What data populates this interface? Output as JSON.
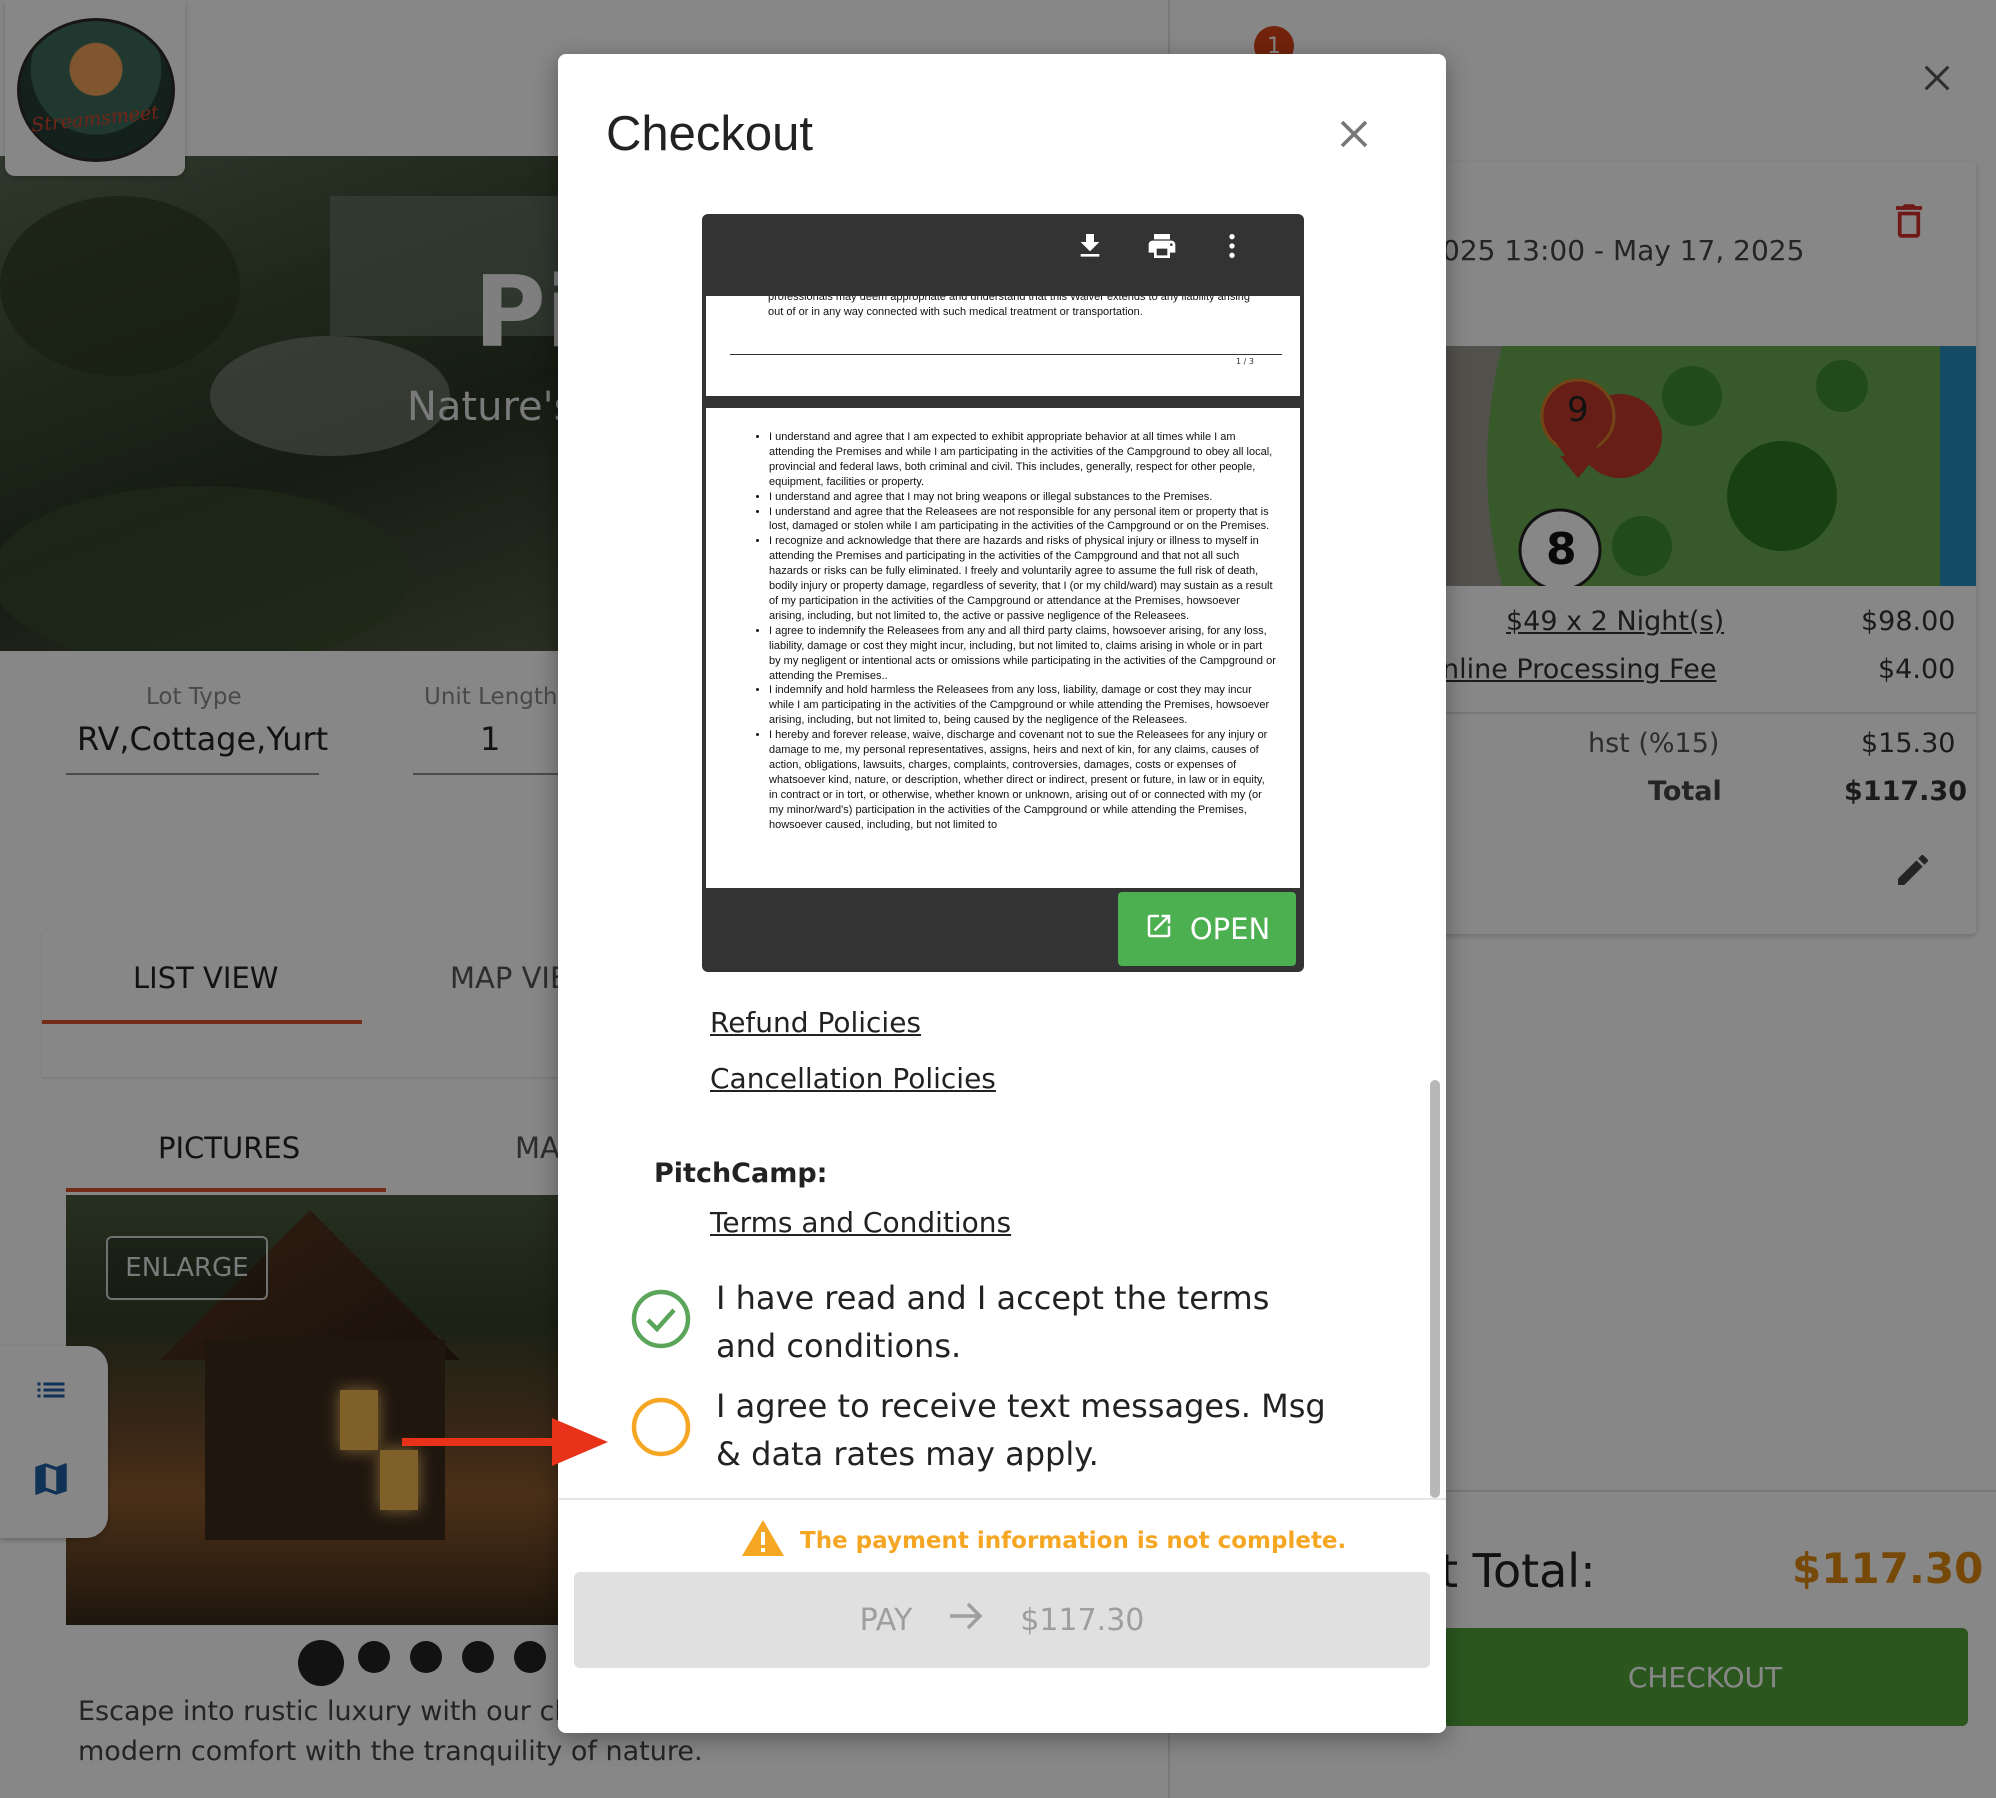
{
  "background": {
    "hero": {
      "title": "Pi",
      "subtitle": "Nature's"
    },
    "fields": [
      {
        "label": "Lot Type",
        "value": "RV,Cottage,Yurt"
      },
      {
        "label": "Unit Length",
        "value": "1"
      }
    ],
    "view_tabs": [
      "LIST VIEW",
      "MAP VIE"
    ],
    "media_tabs": [
      "PICTURES",
      "MA"
    ],
    "enlarge_label": "ENLARGE",
    "description": "Escape into rustic luxury with our cha getaway, combining modern comfort with the tranquility of nature."
  },
  "cart": {
    "badge_count": "1",
    "date_range": "025 13:00 - May 17, 2025",
    "map_markers": [
      "9",
      "8"
    ],
    "lines": [
      {
        "label": "$49 x 2 Night(s)",
        "value": "$98.00"
      },
      {
        "label": "nline Processing Fee",
        "value": "$4.00"
      },
      {
        "label": "hst (%15)",
        "value": "$15.30"
      },
      {
        "label": "Total",
        "value": "$117.30"
      }
    ],
    "grand_total_label": "t Total:",
    "grand_total_value": "$117.30",
    "checkout_label": "CHECKOUT"
  },
  "modal": {
    "title": "Checkout",
    "pdf": {
      "page1_tail": "professionals may deem appropriate and understand that this Waiver extends to any liability arising out of or in any way connected with such medical treatment or transportation.",
      "page_number": "1 / 3",
      "bullets": [
        "I understand and agree that I am expected to exhibit appropriate behavior at all times while I am attending the Premises and while I am participating in the activities of the Campground to obey all local, provincial and federal laws, both criminal and civil. This includes, generally, respect for other people, equipment, facilities or property.",
        "I understand and agree that I may not bring weapons or illegal substances to the Premises.",
        "I understand and agree that the Releasees are not responsible for any personal item or property that is lost, damaged or stolen while I am participating in the activities of the Campground or on the Premises.",
        "I recognize and acknowledge that there are hazards and risks of physical injury or illness to myself in attending the Premises and participating in the activities of the Campground and that not all such hazards or risks can be fully eliminated. I freely and voluntarily agree to assume the full risk of death, bodily injury or property damage, regardless of severity, that I (or my child/ward) may sustain as a result of my participation in the activities of the Campground or attendance at the Premises, howsoever arising, including, but not limited to, the active or passive negligence of the Releasees.",
        "I agree to indemnify the Releasees from any and all third party claims, howsoever arising, for any loss, liability, damage or cost they might incur, including, but not limited to, claims arising in whole or in part by my negligent or intentional acts or omissions while participating in the activities of the Campground or attending the Premises..",
        "I indemnify and hold harmless the Releasees from any loss, liability, damage or cost they may incur while I am participating in the activities of the Campground or while attending the Premises, howsoever arising, including, but not limited to, being caused by the negligence of the Releasees.",
        "I hereby and forever release, waive, discharge and covenant not to sue the Releasees for any injury or damage to me, my personal representatives, assigns, heirs and next of kin, for any claims, causes of action, obligations, lawsuits, charges, complaints, controversies, damages, costs or expenses of whatsoever kind, nature, or description, whether direct or indirect, present or future, in law or in equity, in contract or in tort, or otherwise, whether known or unknown, arising out of or connected with my (or my minor/ward's) participation in the activities of the Campground or while attending the Premises, howsoever caused, including, but not limited to"
      ],
      "open_label": "OPEN"
    },
    "refund_link": "Refund Policies",
    "cancellation_link": "Cancellation Policies",
    "pitchcamp_label": "PitchCamp:",
    "terms_link": "Terms and Conditions",
    "accept_terms_text": "I have read and I accept the terms and conditions.",
    "accept_terms_checked": true,
    "sms_text": "I agree to receive text messages. Msg & data rates may apply.",
    "sms_checked": false,
    "warning_text": "The payment information is not complete.",
    "pay_label": "PAY",
    "pay_amount": "$117.30"
  },
  "colors": {
    "accent_orange": "#f5a623",
    "check_green": "#4caf50",
    "arrow_red": "#e8321a",
    "checkout_green": "#52a43b"
  }
}
